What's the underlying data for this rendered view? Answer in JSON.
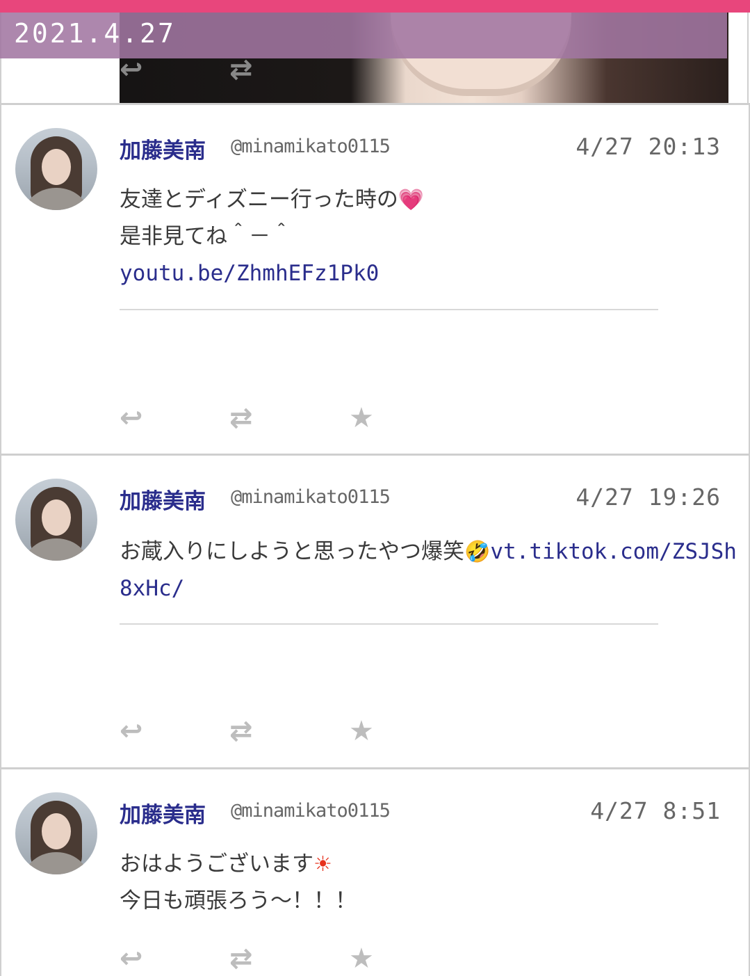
{
  "date_banner": "2021.4.27",
  "icons": {
    "reply": "↩",
    "retweet": "⇄",
    "favorite": "★"
  },
  "tweets": [
    {
      "name": "加藤美南",
      "handle": "@minamikato0115",
      "time": "4/27 20:13",
      "line1": "友達とディズニー行った時の",
      "emoji1": "💗",
      "line2": "是非見てね＾－＾",
      "link": "youtu.be/ZhmhEFz1Pk0"
    },
    {
      "name": "加藤美南",
      "handle": "@minamikato0115",
      "time": "4/27 19:26",
      "text": "お蔵入りにしようと思ったやつ爆笑",
      "emoji1": "🤣",
      "link": "vt.tiktok.com/ZSJSh8xHc/"
    },
    {
      "name": "加藤美南",
      "handle": "@minamikato0115",
      "time": "4/27 8:51",
      "line1": "おはようございます",
      "emoji1": "☀",
      "line2": "今日も頑張ろう〜！！！"
    }
  ]
}
